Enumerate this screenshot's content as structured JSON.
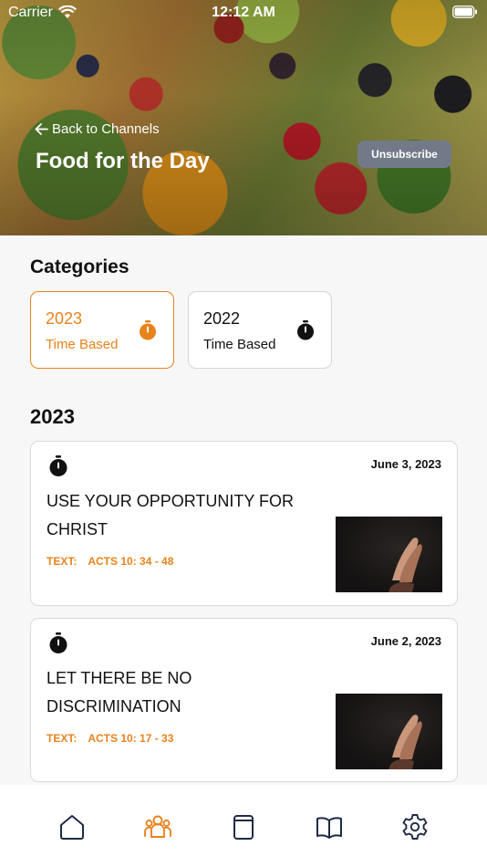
{
  "status": {
    "carrier": "Carrier",
    "time": "12:12 AM"
  },
  "header": {
    "back_label": "Back to Channels",
    "title": "Food for the Day",
    "unsubscribe_label": "Unsubscribe"
  },
  "categories": {
    "heading": "Categories",
    "items": [
      {
        "year": "2023",
        "type": "Time Based",
        "selected": true
      },
      {
        "year": "2022",
        "type": "Time Based",
        "selected": false
      }
    ]
  },
  "feed": {
    "heading": "2023",
    "posts": [
      {
        "date": "June 3, 2023",
        "title": "USE YOUR OPPORTUNITY FOR CHRIST",
        "text_label": "TEXT:",
        "text_ref": "ACTS 10: 34 - 48"
      },
      {
        "date": "June 2, 2023",
        "title": "LET THERE BE NO DISCRIMINATION",
        "text_label": "TEXT:",
        "text_ref": "ACTS 10: 17 - 33"
      }
    ]
  },
  "tabbar": {
    "tabs": [
      "home-icon",
      "community-icon",
      "notes-icon",
      "book-icon",
      "settings-icon"
    ],
    "active_index": 1
  },
  "colors": {
    "accent": "#e8821c",
    "unsubscribe_bg": "#727a8a",
    "icon_dark": "#1f2a44"
  }
}
